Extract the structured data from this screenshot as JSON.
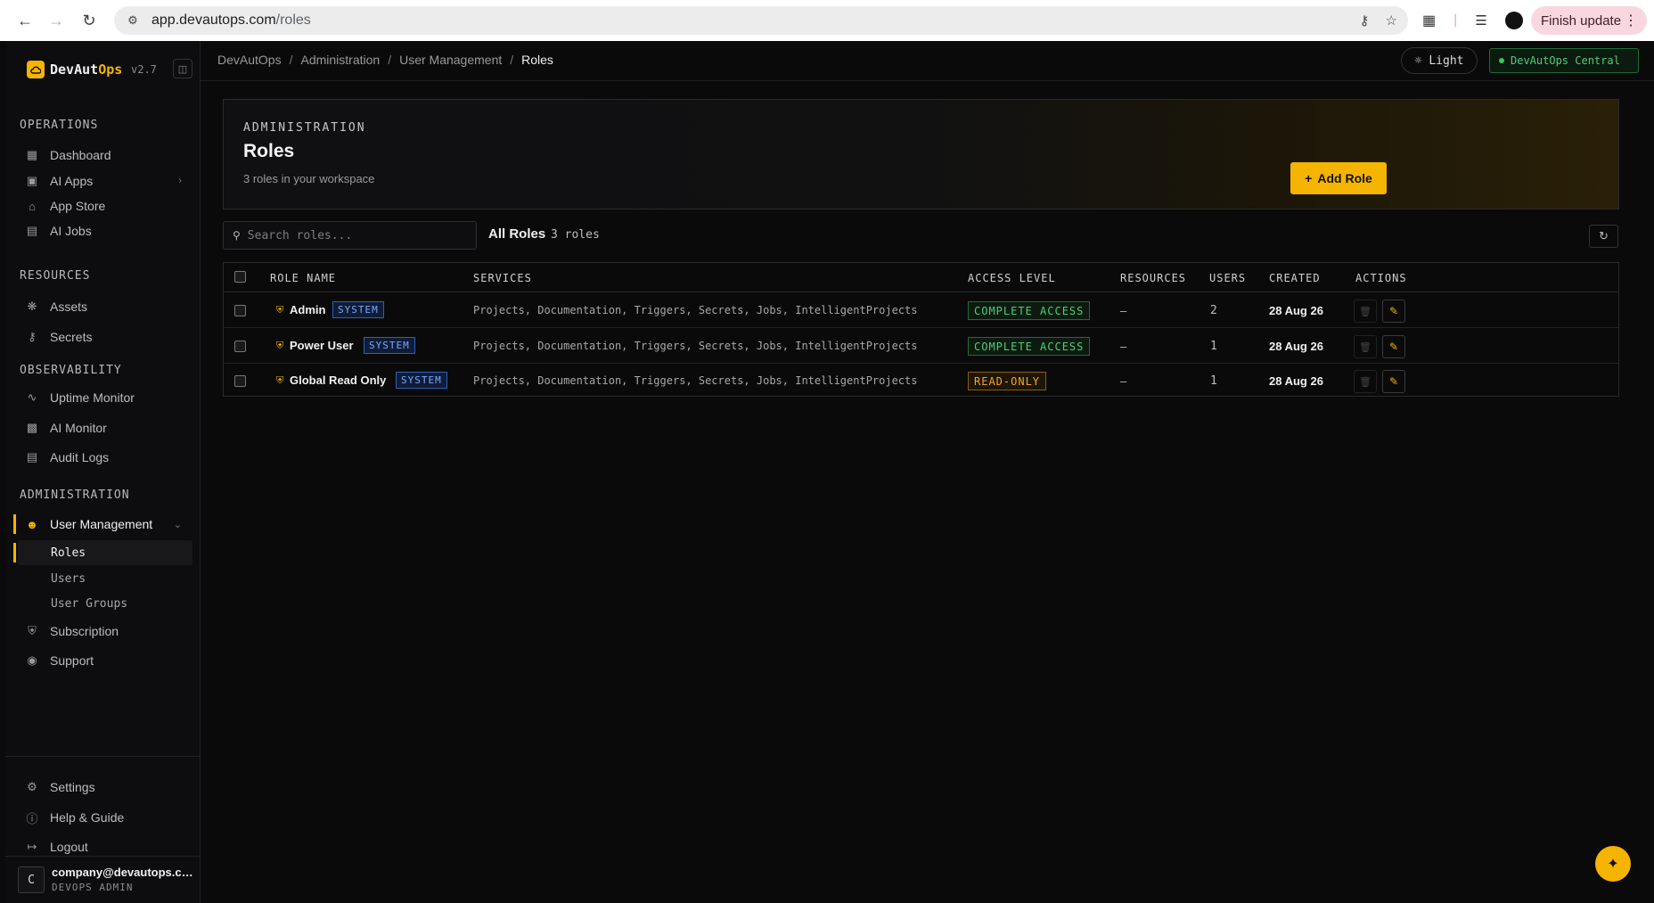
{
  "browser": {
    "url_host": "app.devautops.com",
    "url_path": "/roles",
    "finish_update": "Finish update"
  },
  "sidebar": {
    "brand_prefix": "DevAut",
    "brand_suffix": "Ops",
    "version": "v2.7",
    "sections": {
      "operations": "OPERATIONS",
      "resources": "RESOURCES",
      "observability": "OBSERVABILITY",
      "administration": "ADMINISTRATION"
    },
    "items": {
      "dashboard": "Dashboard",
      "ai_apps": "AI Apps",
      "app_store": "App Store",
      "ai_jobs": "AI Jobs",
      "assets": "Assets",
      "secrets": "Secrets",
      "uptime_monitor": "Uptime Monitor",
      "ai_monitor": "AI Monitor",
      "audit_logs": "Audit Logs",
      "user_management": "User Management",
      "roles": "Roles",
      "users": "Users",
      "user_groups": "User Groups",
      "subscription": "Subscription",
      "support": "Support",
      "settings": "Settings",
      "help": "Help & Guide",
      "logout": "Logout"
    },
    "user": {
      "initial": "C",
      "email": "company@devautops.com",
      "role": "DEVOPS ADMIN"
    }
  },
  "header": {
    "breadcrumb": [
      "DevAutOps",
      "Administration",
      "User Management",
      "Roles"
    ],
    "theme_label": "Light",
    "env_label": "DevAutOps Central"
  },
  "hero": {
    "eyebrow": "ADMINISTRATION",
    "title": "Roles",
    "subtitle": "3 roles in your workspace",
    "add_button": "Add Role"
  },
  "toolbar": {
    "search_placeholder": "Search roles...",
    "heading": "All Roles",
    "count": "3 roles"
  },
  "table": {
    "columns": [
      "ROLE NAME",
      "SERVICES",
      "ACCESS LEVEL",
      "RESOURCES",
      "USERS",
      "CREATED",
      "ACTIONS"
    ],
    "system_badge": "SYSTEM",
    "rows": [
      {
        "name": "Admin",
        "services": "Projects, Documentation, Triggers, Secrets, Jobs, IntelligentProjects",
        "access": "COMPLETE ACCESS",
        "resources": "–",
        "users": "2",
        "created": "28 Aug 26"
      },
      {
        "name": "Power User",
        "services": "Projects, Documentation, Triggers, Secrets, Jobs, IntelligentProjects",
        "access": "COMPLETE ACCESS",
        "resources": "–",
        "users": "1",
        "created": "28 Aug 26"
      },
      {
        "name": "Global Read Only",
        "services": "Projects, Documentation, Triggers, Secrets, Jobs, IntelligentProjects",
        "access": "READ-ONLY",
        "resources": "–",
        "users": "1",
        "created": "28 Aug 26"
      }
    ]
  },
  "colors": {
    "accent": "#f5b400",
    "success": "#4fcf75",
    "warning": "#f5a623",
    "info": "#7aa7ff"
  }
}
